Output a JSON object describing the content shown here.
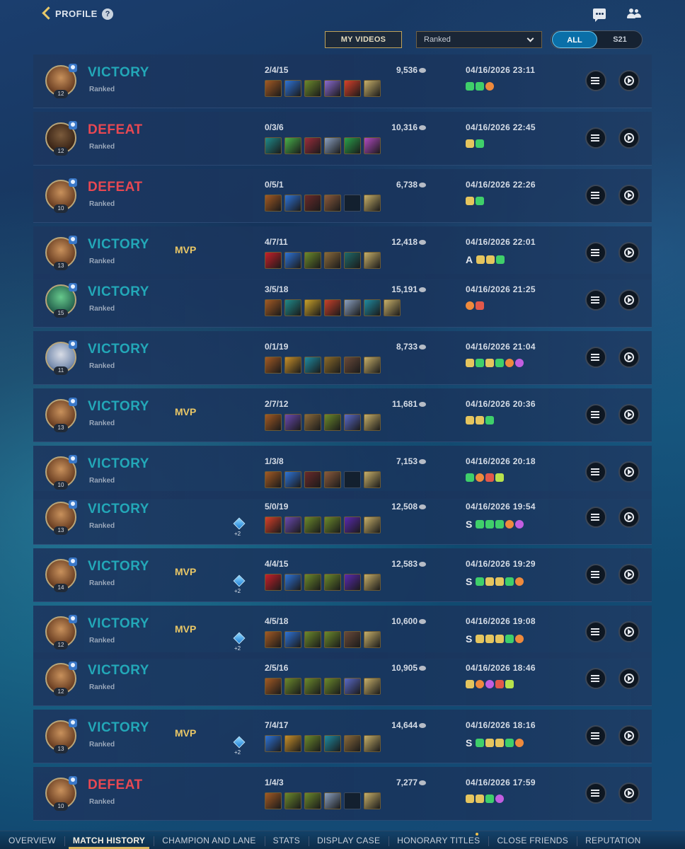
{
  "header": {
    "back_label": "PROFILE",
    "help_glyph": "?"
  },
  "controls": {
    "my_videos_label": "MY VIDEOS",
    "mode_select_value": "Ranked",
    "filter_all_label": "ALL",
    "filter_season_label": "S21"
  },
  "matches": [
    {
      "result": "VICTORY",
      "outcome": "win",
      "mode": "Ranked",
      "level": "12",
      "portrait": "",
      "mvp": "",
      "gem": "",
      "kda": "2/4/15",
      "gold": "9,536",
      "date": "04/16/2026 23:11",
      "items": [
        "#a35a24",
        "#2e73d6",
        "#6b8a2c",
        "#8a6ad0",
        "#d8402a",
        "#c8b06a"
      ],
      "badge_letter": "",
      "badges": [
        "g",
        "g",
        "o"
      ]
    },
    {
      "result": "DEFEAT",
      "outcome": "loss",
      "mode": "Ranked",
      "level": "12",
      "portrait": "alt1",
      "mvp": "",
      "gem": "",
      "kda": "0/3/6",
      "gold": "10,316",
      "date": "04/16/2026 22:45",
      "items": [
        "#1f8a8a",
        "#48b04a",
        "#9a2d3c",
        "#8aa0c0",
        "#2aa04a",
        "#b04ac0"
      ],
      "badge_letter": "",
      "badges": [
        "y",
        "g"
      ]
    },
    {
      "result": "DEFEAT",
      "outcome": "loss",
      "mode": "Ranked",
      "level": "10",
      "portrait": "",
      "mvp": "",
      "gem": "",
      "kda": "0/5/1",
      "gold": "6,738",
      "date": "04/16/2026 22:26",
      "items": [
        "#a35a24",
        "#2e73d6",
        "#6a2a2a",
        "#8a5a3c",
        "empty",
        "#c8b06a"
      ],
      "badge_letter": "",
      "badges": [
        "y",
        "g"
      ]
    },
    {
      "result": "VICTORY",
      "outcome": "win",
      "mode": "Ranked",
      "level": "13",
      "portrait": "",
      "mvp": "MVP",
      "gem": "",
      "kda": "4/7/11",
      "gold": "12,418",
      "date": "04/16/2026 22:01",
      "items": [
        "#c8202a",
        "#2e73d6",
        "#6b8a2c",
        "#8a6a3c",
        "#1f6a6a",
        "#c8b06a"
      ],
      "badge_letter": "A",
      "badges": [
        "y",
        "y",
        "g"
      ]
    },
    {
      "result": "VICTORY",
      "outcome": "win",
      "mode": "Ranked",
      "level": "15",
      "portrait": "alt2",
      "mvp": "",
      "gem": "",
      "kda": "3/5/18",
      "gold": "15,191",
      "date": "04/16/2026 21:25",
      "items": [
        "#a35a24",
        "#1f8a8a",
        "#c8a02a",
        "#c8402a",
        "#8aa0c0",
        "#1f8aa0",
        "#c8b06a"
      ],
      "badge_letter": "",
      "badges": [
        "o",
        "r"
      ]
    },
    {
      "result": "VICTORY",
      "outcome": "win",
      "mode": "Ranked",
      "level": "11",
      "portrait": "alt3",
      "mvp": "",
      "gem": "",
      "kda": "0/1/19",
      "gold": "8,733",
      "date": "04/16/2026 21:04",
      "items": [
        "#a35a24",
        "#c8902a",
        "#1f8aa0",
        "#8a6a2a",
        "#6a4a3a",
        "#c8b06a"
      ],
      "badge_letter": "",
      "badges": [
        "y",
        "g",
        "y",
        "g",
        "o",
        "p"
      ]
    },
    {
      "result": "VICTORY",
      "outcome": "win",
      "mode": "Ranked",
      "level": "13",
      "portrait": "",
      "mvp": "MVP",
      "gem": "",
      "kda": "2/7/12",
      "gold": "11,681",
      "date": "04/16/2026 20:36",
      "items": [
        "#a35a24",
        "#6a4ab0",
        "#8a6a3c",
        "#6b8a2c",
        "#5a6ac8",
        "#c8b06a"
      ],
      "badge_letter": "",
      "badges": [
        "y",
        "y",
        "g"
      ]
    },
    {
      "result": "VICTORY",
      "outcome": "win",
      "mode": "Ranked",
      "level": "10",
      "portrait": "",
      "mvp": "",
      "gem": "",
      "kda": "1/3/8",
      "gold": "7,153",
      "date": "04/16/2026 20:18",
      "items": [
        "#a35a24",
        "#2e73d6",
        "#6a2a2a",
        "#8a5a3c",
        "empty",
        "#c8b06a"
      ],
      "badge_letter": "",
      "badges": [
        "g",
        "o",
        "r",
        "l"
      ]
    },
    {
      "result": "VICTORY",
      "outcome": "win",
      "mode": "Ranked",
      "level": "13",
      "portrait": "",
      "mvp": "",
      "gem": "+2",
      "kda": "5/0/19",
      "gold": "12,508",
      "date": "04/16/2026 19:54",
      "items": [
        "#d8402a",
        "#6a4ab0",
        "#6b8a2c",
        "#6b8a2c",
        "#5a2ab0",
        "#c8b06a"
      ],
      "badge_letter": "S",
      "badges": [
        "g",
        "g",
        "g",
        "o",
        "p"
      ]
    },
    {
      "result": "VICTORY",
      "outcome": "win",
      "mode": "Ranked",
      "level": "14",
      "portrait": "",
      "mvp": "MVP",
      "gem": "+2",
      "kda": "4/4/15",
      "gold": "12,583",
      "date": "04/16/2026 19:29",
      "items": [
        "#c8202a",
        "#2e73d6",
        "#6b8a2c",
        "#6b8a2c",
        "#5a2ab0",
        "#c8b06a"
      ],
      "badge_letter": "S",
      "badges": [
        "g",
        "y",
        "y",
        "g",
        "o"
      ]
    },
    {
      "result": "VICTORY",
      "outcome": "win",
      "mode": "Ranked",
      "level": "12",
      "portrait": "",
      "mvp": "MVP",
      "gem": "+2",
      "kda": "4/5/18",
      "gold": "10,600",
      "date": "04/16/2026 19:08",
      "items": [
        "#a35a24",
        "#2e73d6",
        "#6b8a2c",
        "#6b8a2c",
        "#6a4a3a",
        "#c8b06a"
      ],
      "badge_letter": "S",
      "badges": [
        "y",
        "y",
        "y",
        "g",
        "o"
      ]
    },
    {
      "result": "VICTORY",
      "outcome": "win",
      "mode": "Ranked",
      "level": "12",
      "portrait": "",
      "mvp": "",
      "gem": "",
      "kda": "2/5/16",
      "gold": "10,905",
      "date": "04/16/2026 18:46",
      "items": [
        "#a35a24",
        "#6b8a2c",
        "#6b8a2c",
        "#6b8a2c",
        "#5a6ac8",
        "#c8b06a"
      ],
      "badge_letter": "",
      "badges": [
        "y",
        "o",
        "p",
        "r",
        "l"
      ]
    },
    {
      "result": "VICTORY",
      "outcome": "win",
      "mode": "Ranked",
      "level": "13",
      "portrait": "",
      "mvp": "MVP",
      "gem": "+2",
      "kda": "7/4/17",
      "gold": "14,644",
      "date": "04/16/2026 18:16",
      "items": [
        "#2e73d6",
        "#c8902a",
        "#6b8a2c",
        "#1f8aa0",
        "#8a6a3c",
        "#c8b06a"
      ],
      "badge_letter": "S",
      "badges": [
        "g",
        "y",
        "y",
        "g",
        "o"
      ]
    },
    {
      "result": "DEFEAT",
      "outcome": "loss",
      "mode": "Ranked",
      "level": "10",
      "portrait": "",
      "mvp": "",
      "gem": "",
      "kda": "1/4/3",
      "gold": "7,277",
      "date": "04/16/2026 17:59",
      "items": [
        "#a35a24",
        "#6b8a2c",
        "#6b8a2c",
        "#8aa0c0",
        "empty",
        "#c8b06a"
      ],
      "badge_letter": "",
      "badges": [
        "y",
        "y",
        "g",
        "p"
      ]
    }
  ],
  "nav": {
    "tabs": [
      "OVERVIEW",
      "MATCH HISTORY",
      "CHAMPION AND LANE",
      "STATS",
      "DISPLAY CASE",
      "HONORARY TITLES",
      "CLOSE FRIENDS",
      "REPUTATION"
    ],
    "active_index": 1,
    "notification_index": 5
  },
  "colors": {
    "victory": "#23a8b8",
    "defeat": "#e84852",
    "mvp": "#e9c766",
    "accent_gold": "#d9b65c",
    "active_filter": "#0a6fa8"
  },
  "icons": {
    "back": "chevron-left-icon",
    "help": "help-icon",
    "chat": "chat-icon",
    "friends": "friends-icon",
    "details": "list-icon",
    "replay": "play-icon",
    "party": "party-icon",
    "gold": "coin-icon",
    "gem": "crystal-icon"
  }
}
